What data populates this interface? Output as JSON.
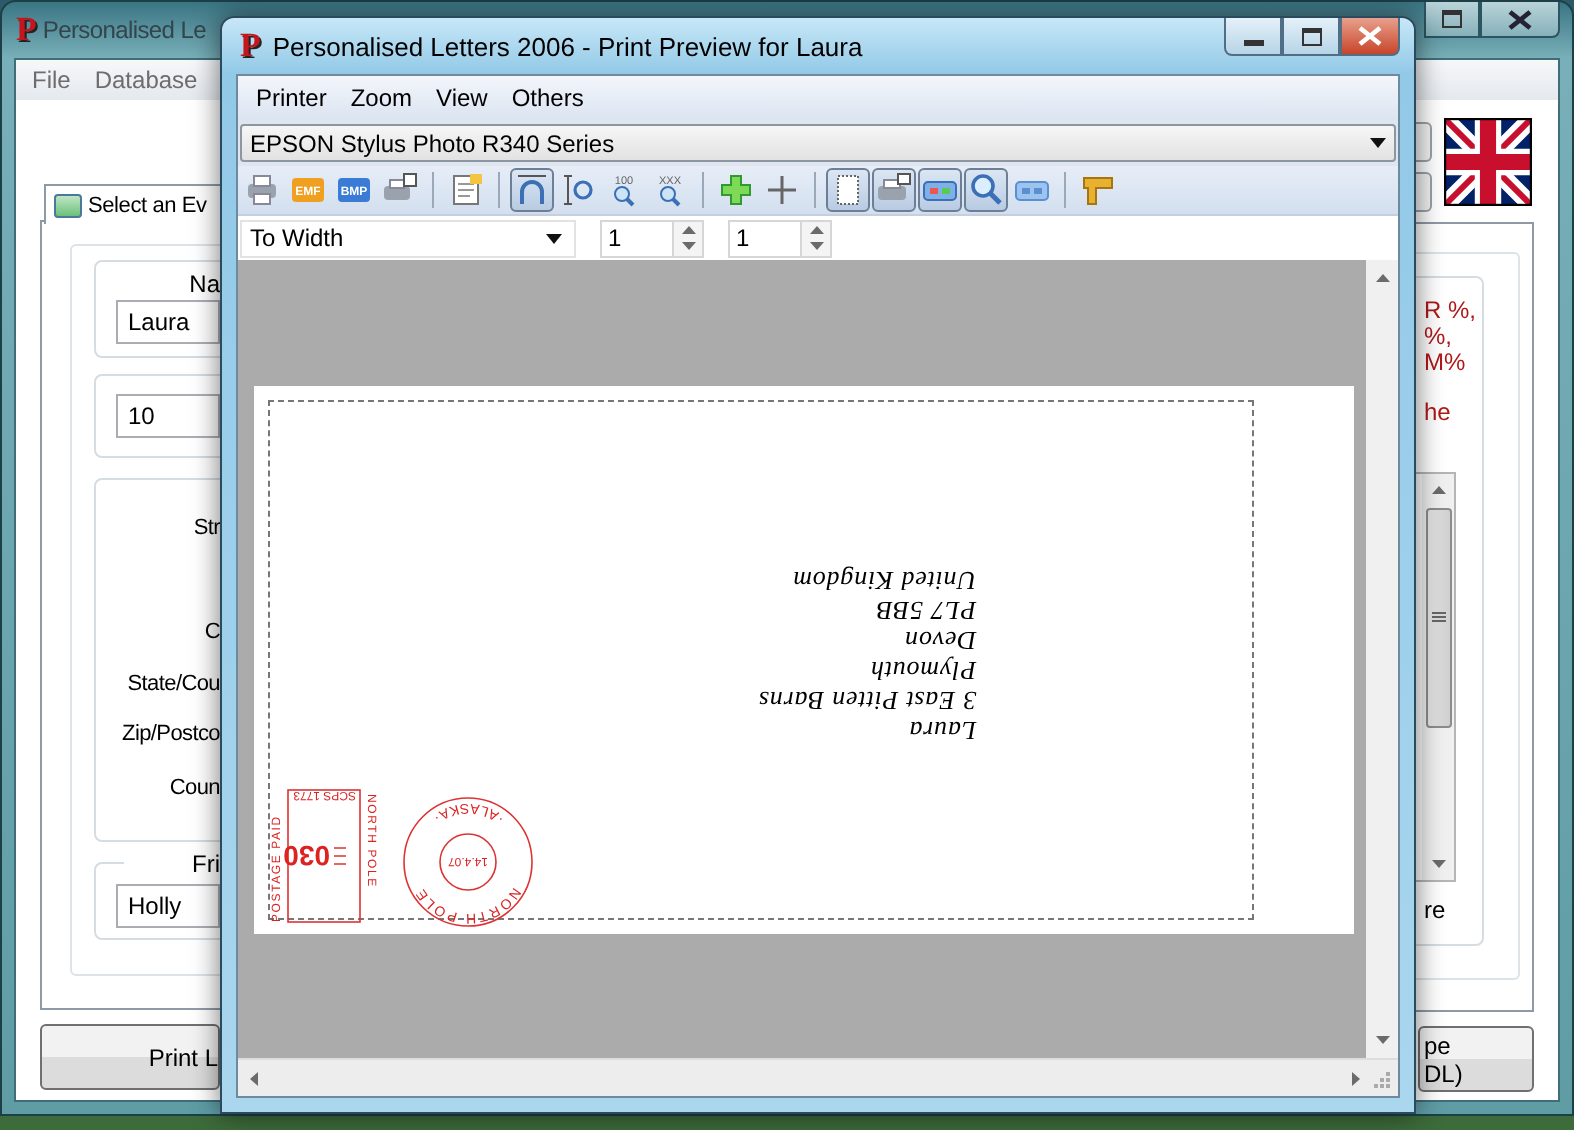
{
  "main_window": {
    "logo": "P",
    "title": "Personalised Le",
    "menu": [
      "File",
      "Database"
    ],
    "tab": {
      "label": "Select an Ev",
      "selected": true
    },
    "name_group": {
      "label": "Na",
      "value": "Laura"
    },
    "number_field": {
      "value": "10"
    },
    "address_labels": [
      "Str",
      "C",
      "State/Cou",
      "Zip/Postco",
      "Coun"
    ],
    "friend_group": {
      "label": "Fri",
      "value": "Holly"
    },
    "print_button": "Print L",
    "notes": [
      [
        "R %,",
        "%,",
        "M%"
      ],
      [
        "he"
      ]
    ],
    "list_caption": "re",
    "envelope_button": [
      "pe",
      "DL)"
    ]
  },
  "preview_window": {
    "logo": "P",
    "title": "Personalised Letters 2006 - Print Preview for Laura",
    "menu": [
      "Printer",
      "Zoom",
      "View",
      "Others"
    ],
    "printer": "EPSON Stylus Photo R340 Series",
    "toolbar": [
      [
        {
          "kind": "print",
          "pressed": false
        },
        {
          "kind": "emf",
          "label": "EMF",
          "pressed": false
        },
        {
          "kind": "bmp",
          "label": "BMP",
          "pressed": false
        },
        {
          "kind": "printer-setup",
          "pressed": false
        }
      ],
      [
        {
          "kind": "page-setup",
          "pressed": false
        }
      ],
      [
        {
          "kind": "fit-page",
          "pressed": true
        },
        {
          "kind": "fit-height",
          "pressed": false
        },
        {
          "kind": "zoom",
          "label": "100",
          "pressed": false
        },
        {
          "kind": "zoom",
          "label": "XXX",
          "pressed": false
        }
      ],
      [
        {
          "kind": "zoom-in",
          "pressed": false
        },
        {
          "kind": "plus",
          "pressed": false
        }
      ],
      [
        {
          "kind": "page",
          "pressed": true
        },
        {
          "kind": "printer",
          "pressed": true
        },
        {
          "kind": "colors",
          "pressed": true
        },
        {
          "kind": "search",
          "pressed": true
        },
        {
          "kind": "frame",
          "pressed": false
        }
      ],
      [
        {
          "kind": "ruler",
          "pressed": false
        }
      ]
    ],
    "zoom_mode": "To Width",
    "page_from": "1",
    "page_to": "1",
    "envelope": {
      "address": [
        "Laura",
        "3 East Pitten Barns",
        "Plymouth",
        "Devon",
        "PL7 5BB",
        "United Kingdom"
      ],
      "meter": {
        "caption": "POSTAGE PAID",
        "place": "NORTH POLE",
        "serial": "SCPS 1773",
        "amount": "030"
      },
      "postmark": {
        "place": "NORTH POLE",
        "state": "·ALASKA·",
        "date": "14.4.07"
      }
    }
  }
}
